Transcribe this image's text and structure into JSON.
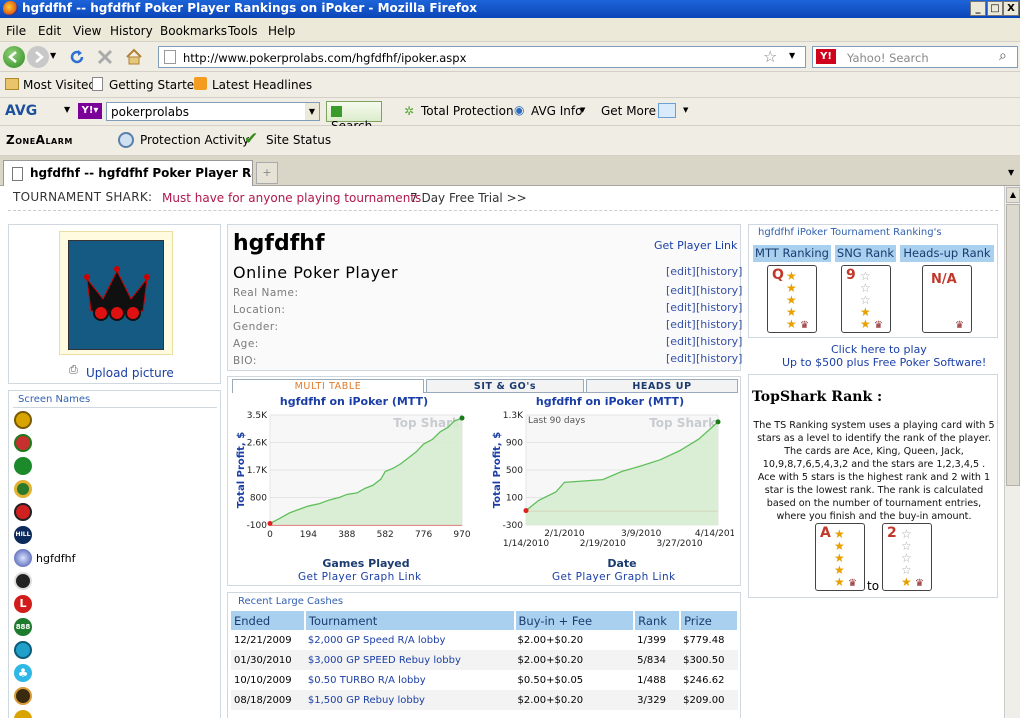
{
  "window": {
    "title": "hgfdfhf -- hgfdfhf Poker Player Rankings on iPoker - Mozilla Firefox",
    "controls": [
      "_",
      "□",
      "X"
    ]
  },
  "menu": [
    "File",
    "Edit",
    "View",
    "History",
    "Bookmarks",
    "Tools",
    "Help"
  ],
  "nav": {
    "url": "http://www.pokerprolabs.com/hgfdfhf/ipoker.aspx",
    "search_placeholder": "Yahoo! Search"
  },
  "bookmarks": [
    "Most Visited",
    "Getting Started",
    "Latest Headlines"
  ],
  "avg": {
    "brand": "AVG",
    "query": "pokerprolabs",
    "search_label": "Search",
    "items": [
      "Total Protection",
      "AVG Info",
      "Get More"
    ]
  },
  "zonealarm": {
    "brand": "ZoneAlarm",
    "items": [
      "Protection Activity",
      "Site Status"
    ]
  },
  "tab": {
    "title": "hgfdfhf -- hgfdfhf Poker Player Ranki..."
  },
  "banner": {
    "label": "TOURNAMENT SHARK:",
    "text": "Must have for anyone playing tournaments",
    "trial": "7 Day Free Trial >>"
  },
  "left": {
    "upload": "Upload picture",
    "screen_names_title": "Screen Names",
    "screen_name": "hgfdfhf"
  },
  "profile": {
    "name": "hgfdfhf",
    "subtitle": "Online Poker Player",
    "get_player_link": "Get Player Link",
    "fields": [
      "Real Name:",
      "Location:",
      "Gender:",
      "Age:",
      "BIO:"
    ],
    "edit": "[edit]",
    "history": "[history]"
  },
  "graph_tabs": [
    "MULTI TABLE",
    "SIT & GO's",
    "HEADS UP"
  ],
  "chart_data": [
    {
      "type": "line",
      "title": "hgfdfhf on iPoker (MTT)",
      "xlabel": "Games Played",
      "ylabel": "Total Profit, $",
      "watermark": "Top Shark",
      "x_ticks": [
        0,
        194,
        388,
        582,
        776,
        970
      ],
      "y_ticks": [
        "-100",
        "800",
        "1.7K",
        "2.6K",
        "3.5K"
      ],
      "xlim": [
        0,
        970
      ],
      "ylim": [
        -100,
        3500
      ],
      "x": [
        0,
        50,
        100,
        150,
        194,
        250,
        300,
        350,
        388,
        440,
        480,
        520,
        560,
        582,
        620,
        660,
        700,
        740,
        776,
        820,
        860,
        900,
        930,
        970
      ],
      "y": [
        -50,
        120,
        300,
        420,
        520,
        600,
        720,
        800,
        900,
        950,
        1100,
        1200,
        1400,
        1650,
        1750,
        1900,
        2100,
        2300,
        2550,
        2700,
        2950,
        3100,
        3300,
        3400
      ],
      "link": "Get Player Graph Link"
    },
    {
      "type": "line",
      "title": "hgfdfhf on iPoker (MTT)",
      "subtitle": "Last 90 days",
      "xlabel": "Date",
      "ylabel": "Total Profit, $",
      "watermark": "Top Shark",
      "x_ticks_top": [
        "2/1/2010",
        "3/9/2010",
        "4/14/2010"
      ],
      "x_ticks_bottom": [
        "1/14/2010",
        "2/19/2010",
        "3/27/2010"
      ],
      "y_ticks": [
        "-300",
        "100",
        "500",
        "900",
        "1.3K"
      ],
      "ylim": [
        -300,
        1300
      ],
      "x": [
        "1/14/2010",
        "1/20/2010",
        "1/28/2010",
        "2/1/2010",
        "2/10/2010",
        "2/19/2010",
        "2/28/2010",
        "3/9/2010",
        "3/18/2010",
        "3/27/2010",
        "4/5/2010",
        "4/14/2010"
      ],
      "y": [
        -90,
        60,
        180,
        320,
        340,
        360,
        480,
        560,
        650,
        780,
        950,
        1200
      ],
      "link": "Get Player Graph Link"
    }
  ],
  "cashes": {
    "title": "Recent Large Cashes",
    "headers": [
      "Ended",
      "Tournament",
      "Buy-in + Fee",
      "Rank",
      "Prize"
    ],
    "rows": [
      [
        "12/21/2009",
        "$2,000 GP Speed R/A lobby",
        "$2.00+$0.20",
        "1/399",
        "$779.48"
      ],
      [
        "01/30/2010",
        "$3,000 GP SPEED Rebuy lobby",
        "$2.00+$0.20",
        "5/834",
        "$300.50"
      ],
      [
        "10/10/2009",
        "$0.50 TURBO R/A lobby",
        "$0.50+$0.05",
        "1/488",
        "$246.62"
      ],
      [
        "08/18/2009",
        "$1,500 GP Rebuy lobby",
        "$2.00+$0.20",
        "3/329",
        "$209.00"
      ]
    ]
  },
  "rankings": {
    "title": "hgfdfhf iPoker Tournament Ranking's",
    "headers": [
      "MTT Ranking",
      "SNG Rank",
      "Heads-up Rank"
    ],
    "cards": [
      {
        "rank": "Q",
        "stars": 5
      },
      {
        "rank": "9",
        "stars": 2
      },
      {
        "rank": "N/A",
        "stars": 0
      }
    ],
    "promo1": "Click here to play",
    "promo2": "Up to $500 plus Free Poker Software!"
  },
  "topshark": {
    "title": "TopShark Rank :",
    "text": "The TS Ranking system uses a playing card with 5 stars as a level to identify the rank of the player. The cards are Ace, King, Queen, Jack, 10,9,8,7,6,5,4,3,2 and the stars are 1,2,3,4,5 . Ace with 5 stars is the highest rank and 2 with 1 star is the lowest rank. The rank is calculated based on the number of tournament entries, where you finish and the buy-in amount.",
    "card_high": "A",
    "card_low": "2",
    "to": "to"
  },
  "colors": {
    "title_bar": "#0b45b8",
    "link": "#1a3ea6",
    "header_blue": "#a9d1ef",
    "banner_red": "#b0184e",
    "chart_fill": "#d6ecd2",
    "chart_line": "#5fbf5a"
  }
}
